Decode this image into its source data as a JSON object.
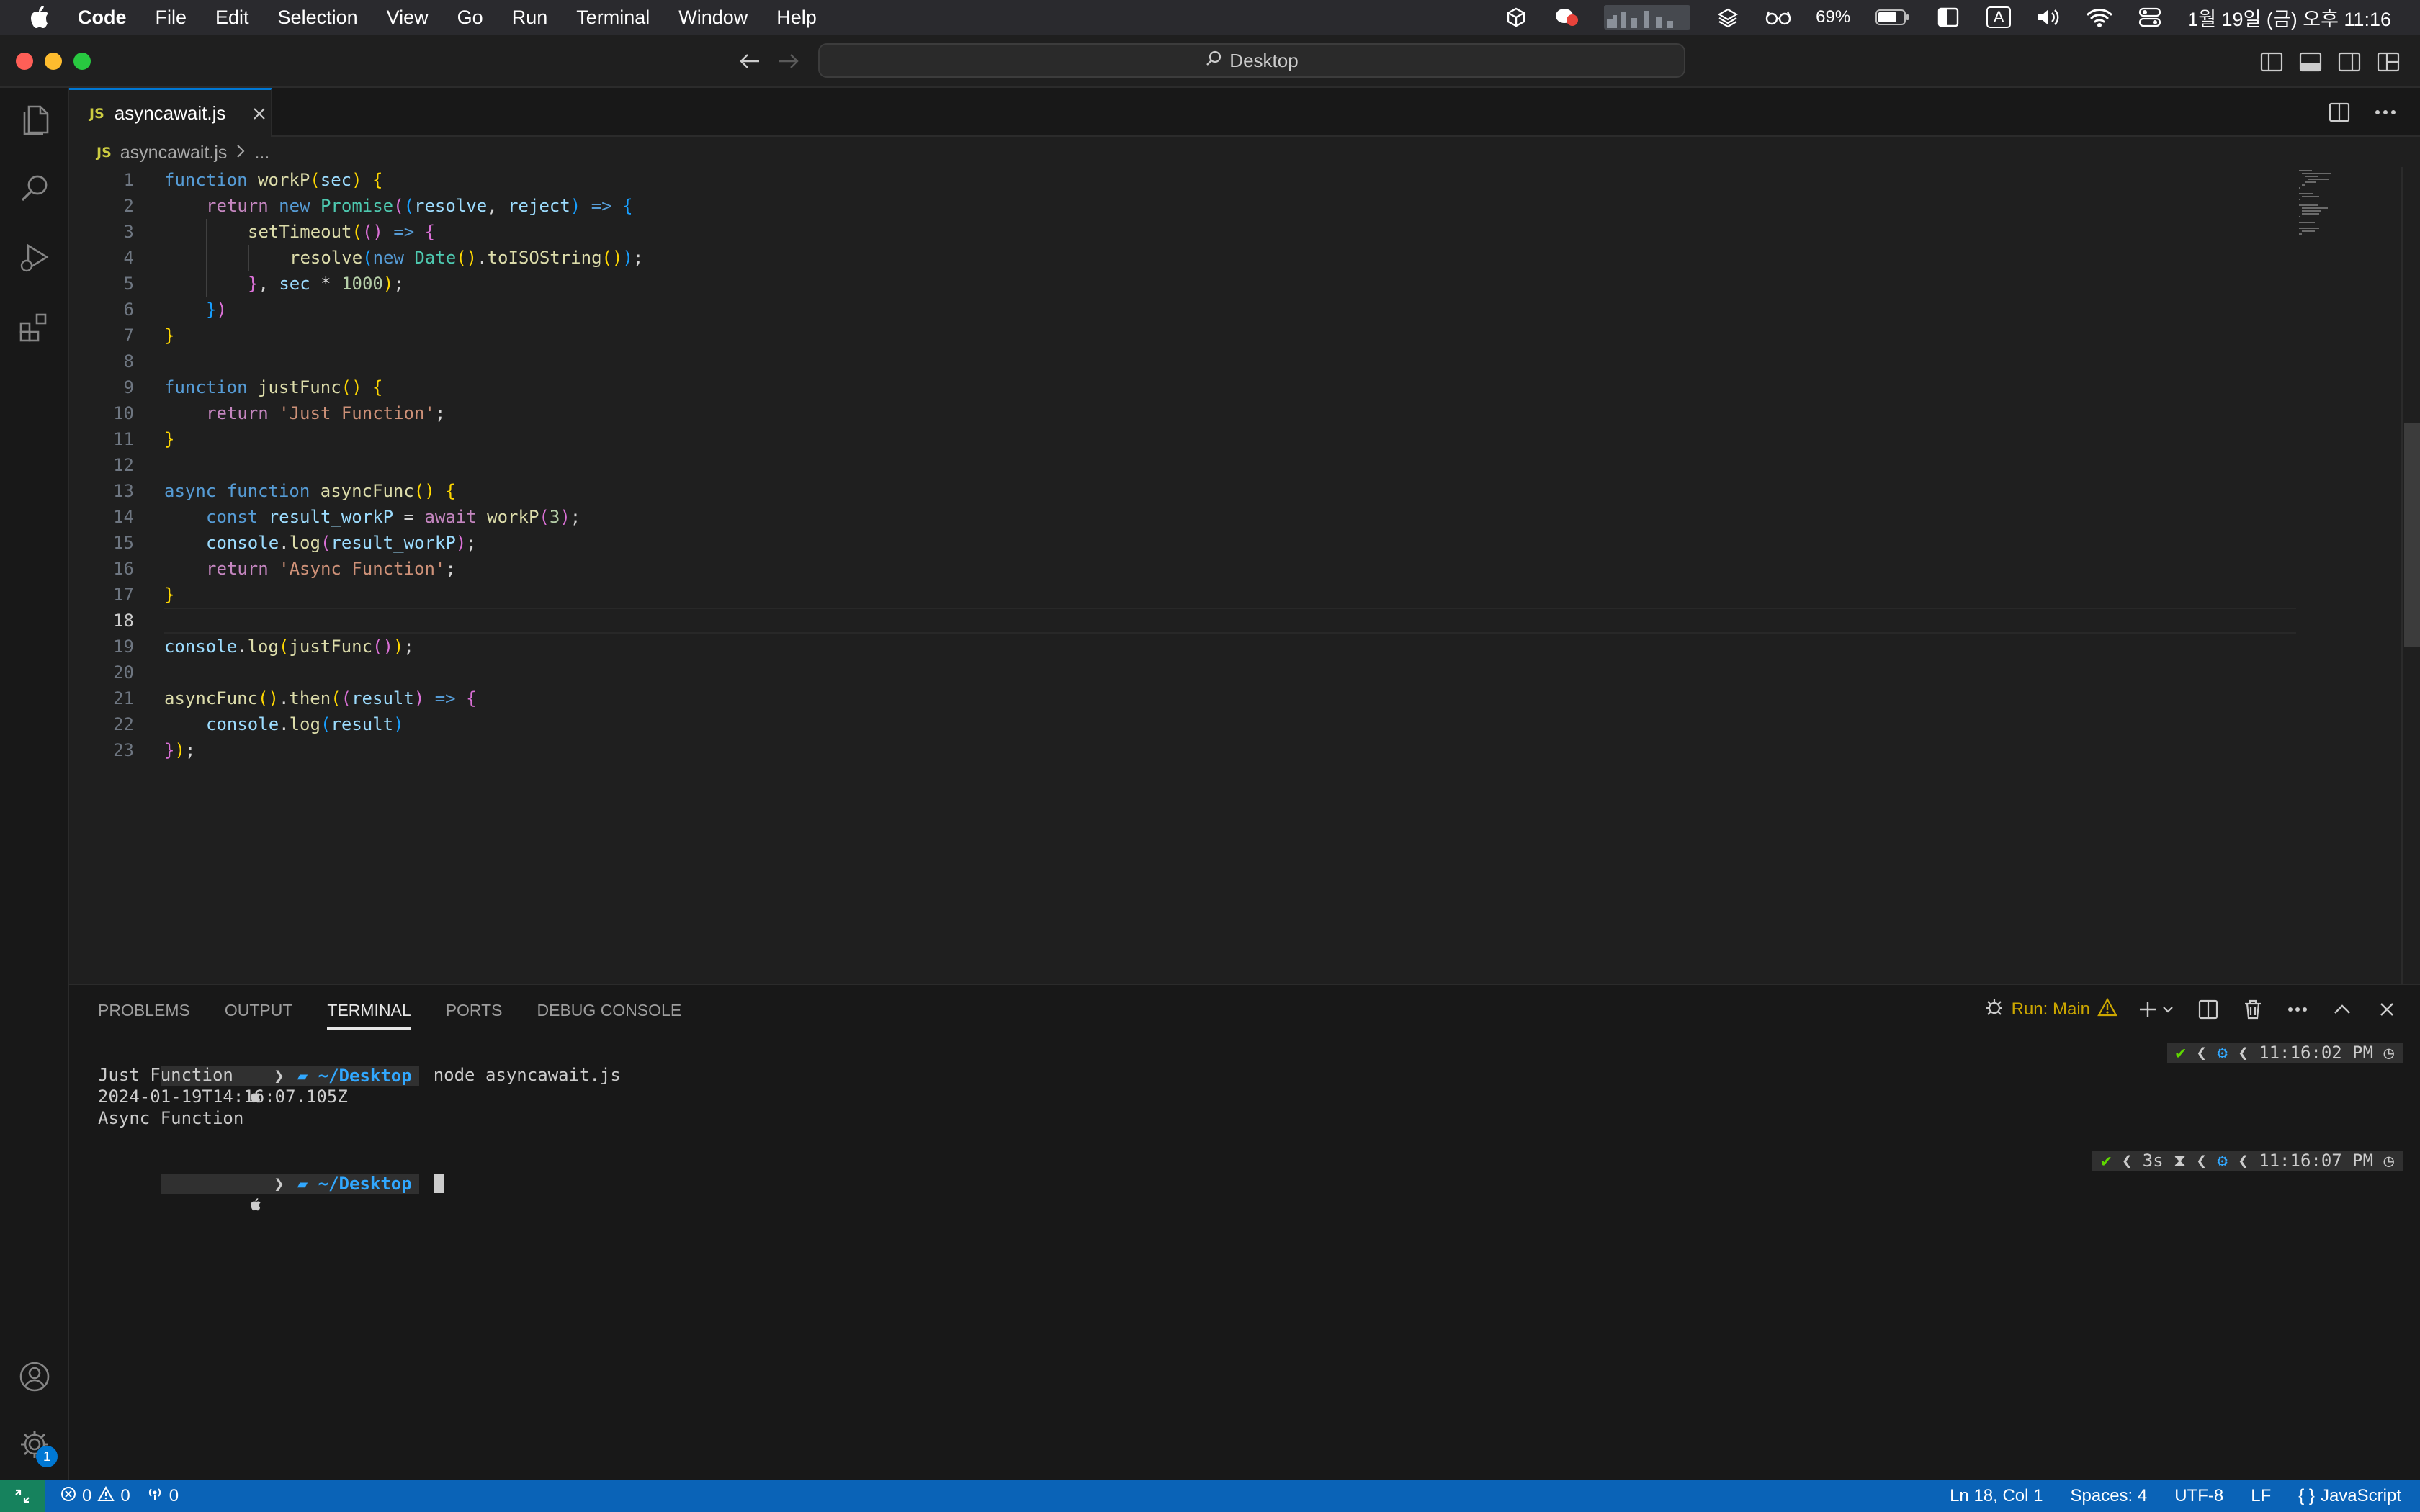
{
  "menubar": {
    "app": "Code",
    "items": [
      "File",
      "Edit",
      "Selection",
      "View",
      "Go",
      "Run",
      "Terminal",
      "Window",
      "Help"
    ],
    "battery": "69%",
    "input_indicator": "A",
    "clock": "1월 19일 (금) 오후 11:16"
  },
  "titlebar": {
    "search_label": "Desktop"
  },
  "tab": {
    "icon_text": "JS",
    "filename": "asyncawait.js"
  },
  "breadcrumb": {
    "icon_text": "JS",
    "file": "asyncawait.js",
    "more": "..."
  },
  "editor": {
    "line_numbers": [
      "1",
      "2",
      "3",
      "4",
      "5",
      "6",
      "7",
      "8",
      "9",
      "10",
      "11",
      "12",
      "13",
      "14",
      "15",
      "16",
      "17",
      "18",
      "19",
      "20",
      "21",
      "22",
      "23"
    ],
    "code_lines": [
      "function workP(sec) {",
      "    return new Promise((resolve, reject) => {",
      "        setTimeout(() => {",
      "            resolve(new Date().toISOString());",
      "        }, sec * 1000);",
      "    })",
      "}",
      "",
      "function justFunc() {",
      "    return 'Just Function';",
      "}",
      "",
      "async function asyncFunc() {",
      "    const result_workP = await workP(3);",
      "    console.log(result_workP);",
      "    return 'Async Function';",
      "}",
      "",
      "console.log(justFunc());",
      "",
      "asyncFunc().then((result) => {",
      "    console.log(result)",
      "});"
    ],
    "current_line": 18
  },
  "panel": {
    "tabs": [
      "PROBLEMS",
      "OUTPUT",
      "TERMINAL",
      "PORTS",
      "DEBUG CONSOLE"
    ],
    "active_tab": "TERMINAL",
    "run_label": "Run: Main"
  },
  "terminal": {
    "prompt_dir": "~/Desktop",
    "command": "node asyncawait.js",
    "output": [
      "Just Function",
      "2024-01-19T14:16:07.105Z",
      "Async Function"
    ],
    "rprompt1_time": "11:16:02 PM",
    "rprompt2_duration": "3s",
    "rprompt2_time": "11:16:07 PM"
  },
  "statusbar": {
    "errors": "0",
    "warnings": "0",
    "ports": "0",
    "position": "Ln 18, Col 1",
    "spaces": "Spaces: 4",
    "encoding": "UTF-8",
    "eol": "LF",
    "language": "JavaScript"
  },
  "colors": {
    "accent": "#0078d4",
    "statusbar": "#0a63b7",
    "remote": "#16825d",
    "warning": "#cca700"
  }
}
